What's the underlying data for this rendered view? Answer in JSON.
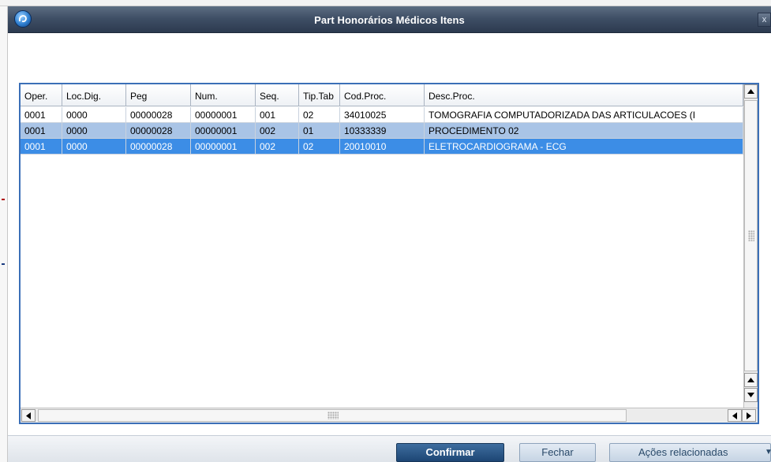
{
  "window": {
    "title": "Part Honorários Médicos Itens",
    "close_label": "x"
  },
  "grid": {
    "columns": [
      "Oper.",
      "Loc.Dig.",
      "Peg",
      "Num.",
      "Seq.",
      "Tip.Tab",
      "Cod.Proc.",
      "Desc.Proc."
    ],
    "rows": [
      [
        "0001",
        "0000",
        "00000028",
        "00000001",
        "001",
        "02",
        "34010025",
        "TOMOGRAFIA COMPUTADORIZADA DAS ARTICULACOES (I"
      ],
      [
        "0001",
        "0000",
        "00000028",
        "00000001",
        "002",
        "01",
        "10333339",
        "PROCEDIMENTO 02"
      ],
      [
        "0001",
        "0000",
        "00000028",
        "00000001",
        "002",
        "02",
        "20010010",
        "ELETROCARDIOGRAMA - ECG"
      ]
    ],
    "selected_row": 2
  },
  "icons": {
    "logo": "app-logo-icon",
    "scroll_up": "arrow-up-icon",
    "scroll_down": "arrow-down-icon",
    "scroll_left": "arrow-left-icon",
    "scroll_right": "arrow-right-icon"
  },
  "footer": {
    "confirm_label": "Confirmar",
    "close_label": "Fechar",
    "actions_label": "Ações relacionadas"
  },
  "colors": {
    "title_bar": "#3f4f66",
    "grid_border": "#3b6fb7",
    "alt_row": "#a9c4e6",
    "selected_row": "#3c8de6",
    "primary_button": "#1d4674"
  }
}
